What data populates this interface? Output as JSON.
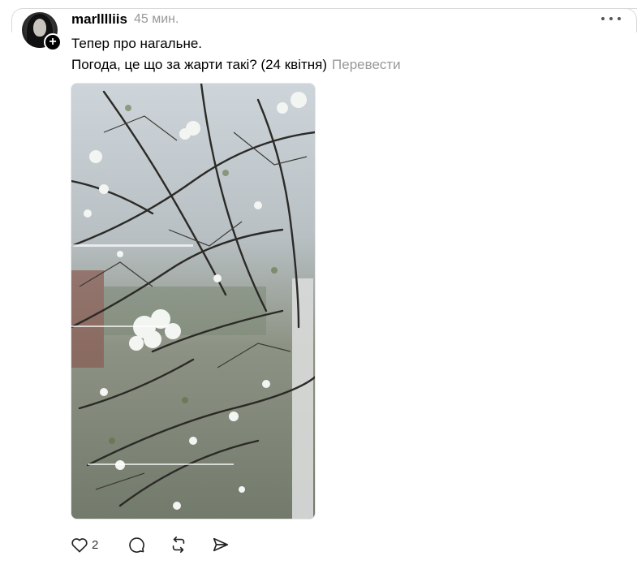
{
  "post": {
    "username": "marlllliis",
    "timestamp": "45 мин.",
    "text_line1": "Тепер про нагальне.",
    "text_line2": "Погода, це що за жарти такі? (24 квітня)",
    "translate_label": "Перевести",
    "photo_alt": "photo",
    "like_count": "2"
  },
  "colors": {
    "accent": "#000000",
    "muted_text": "#999999",
    "border": "#d9d9d9"
  },
  "icons": {
    "more": "more-dots-icon",
    "like": "heart-icon",
    "comment": "comment-bubble-icon",
    "repost": "repost-icon",
    "share": "send-icon",
    "follow": "plus-icon"
  }
}
